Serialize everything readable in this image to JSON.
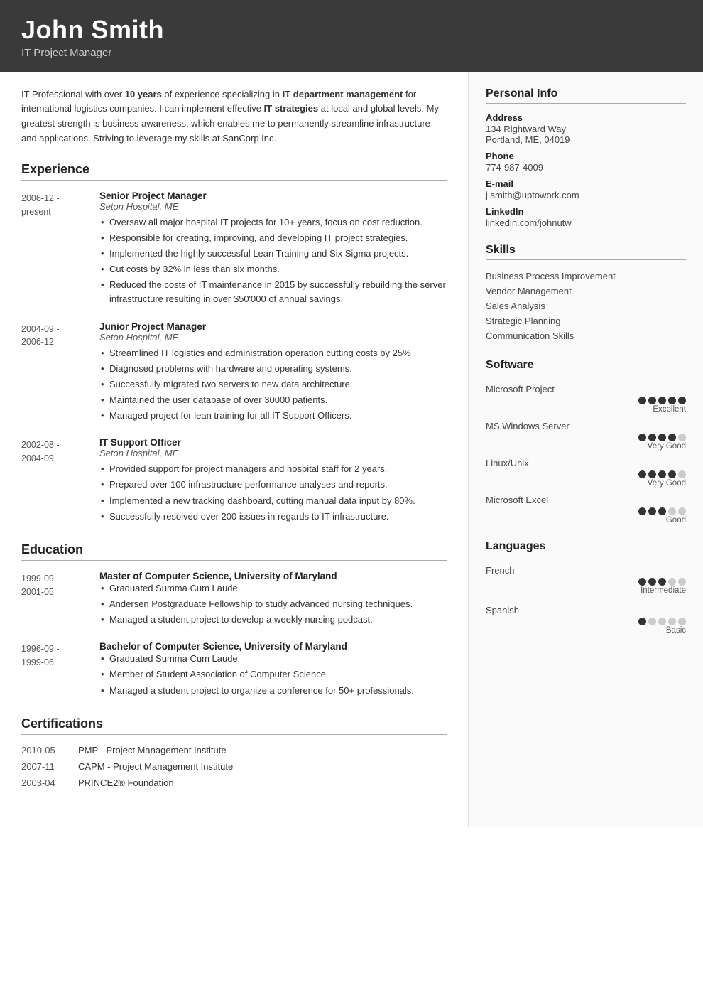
{
  "header": {
    "name": "John Smith",
    "title": "IT Project Manager"
  },
  "summary": "IT Professional with over 10 years of experience specializing in IT department management for international logistics companies. I can implement effective IT strategies at local and global levels. My greatest strength is business awareness, which enables me to permanently streamline infrastructure and applications. Striving to leverage my skills at SanCorp Inc.",
  "sections": {
    "experience_label": "Experience",
    "education_label": "Education",
    "certifications_label": "Certifications"
  },
  "experience": [
    {
      "dates_line1": "2006-12 -",
      "dates_line2": "present",
      "title": "Senior Project Manager",
      "company": "Seton Hospital, ME",
      "bullets": [
        "Oversaw all major hospital IT projects for 10+ years, focus on cost reduction.",
        "Responsible for creating, improving, and developing IT project strategies.",
        "Implemented the highly successful Lean Training and Six Sigma projects.",
        "Cut costs by 32% in less than six months.",
        "Reduced the costs of IT maintenance in 2015 by successfully rebuilding the server infrastructure resulting in over $50'000 of annual savings."
      ]
    },
    {
      "dates_line1": "2004-09 -",
      "dates_line2": "2006-12",
      "title": "Junior Project Manager",
      "company": "Seton Hospital, ME",
      "bullets": [
        "Streamlined IT logistics and administration operation cutting costs by 25%",
        "Diagnosed problems with hardware and operating systems.",
        "Successfully migrated two servers to new data architecture.",
        "Maintained the user database of over 30000 patients.",
        "Managed project for lean training for all IT Support Officers."
      ]
    },
    {
      "dates_line1": "2002-08 -",
      "dates_line2": "2004-09",
      "title": "IT Support Officer",
      "company": "Seton Hospital, ME",
      "bullets": [
        "Provided support for project managers and hospital staff for 2 years.",
        "Prepared over 100 infrastructure performance analyses and reports.",
        "Implemented a new tracking dashboard, cutting manual data input by 80%.",
        "Successfully resolved over 200 issues in regards to IT infrastructure."
      ]
    }
  ],
  "education": [
    {
      "dates_line1": "1999-09 -",
      "dates_line2": "2001-05",
      "title": "Master of Computer Science, University of Maryland",
      "bullets": [
        "Graduated Summa Cum Laude.",
        "Andersen Postgraduate Fellowship to study advanced nursing techniques.",
        "Managed a student project to develop a weekly nursing podcast."
      ]
    },
    {
      "dates_line1": "1996-09 -",
      "dates_line2": "1999-06",
      "title": "Bachelor of Computer Science, University of Maryland",
      "bullets": [
        "Graduated Summa Cum Laude.",
        "Member of Student Association of Computer Science.",
        "Managed a student project to organize a conference for 50+ professionals."
      ]
    }
  ],
  "certifications": [
    {
      "date": "2010-05",
      "name": "PMP - Project Management Institute"
    },
    {
      "date": "2007-11",
      "name": "CAPM - Project Management Institute"
    },
    {
      "date": "2003-04",
      "name": "PRINCE2® Foundation"
    }
  ],
  "personal_info": {
    "section_label": "Personal Info",
    "address_label": "Address",
    "address_value": "134 Rightward Way\nPortland, ME, 04019",
    "phone_label": "Phone",
    "phone_value": "774-987-4009",
    "email_label": "E-mail",
    "email_value": "j.smith@uptowork.com",
    "linkedin_label": "LinkedIn",
    "linkedin_value": "linkedin.com/johnutw"
  },
  "skills": {
    "section_label": "Skills",
    "items": [
      "Business Process Improvement",
      "Vendor Management",
      "Sales Analysis",
      "Strategic Planning",
      "Communication Skills"
    ]
  },
  "software": {
    "section_label": "Software",
    "items": [
      {
        "name": "Microsoft Project",
        "filled": 5,
        "empty": 0,
        "label": "Excellent"
      },
      {
        "name": "MS Windows Server",
        "filled": 4,
        "empty": 1,
        "label": "Very Good"
      },
      {
        "name": "Linux/Unix",
        "filled": 4,
        "empty": 1,
        "label": "Very Good"
      },
      {
        "name": "Microsoft Excel",
        "filled": 3,
        "empty": 2,
        "label": "Good"
      }
    ]
  },
  "languages": {
    "section_label": "Languages",
    "items": [
      {
        "name": "French",
        "filled": 3,
        "empty": 2,
        "label": "Intermediate"
      },
      {
        "name": "Spanish",
        "filled": 1,
        "empty": 4,
        "label": "Basic"
      }
    ]
  }
}
